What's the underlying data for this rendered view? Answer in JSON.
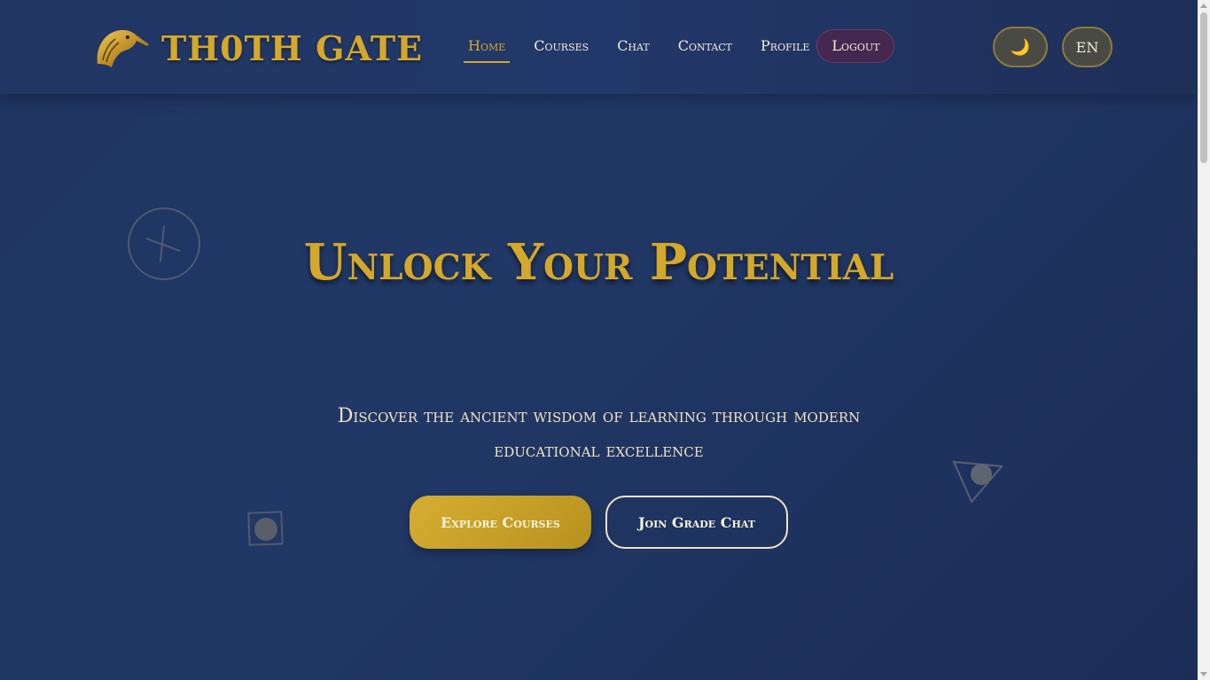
{
  "brand": {
    "name": "TH0TH GATE",
    "logo_icon": "ibis-head-icon"
  },
  "nav": {
    "items": [
      {
        "label": "Home",
        "active": true
      },
      {
        "label": "Courses",
        "active": false
      },
      {
        "label": "Chat",
        "active": false
      },
      {
        "label": "Contact",
        "active": false
      },
      {
        "label": "Profile",
        "active": false
      }
    ],
    "logout_label": "Logout"
  },
  "controls": {
    "theme_icon": "moon-icon",
    "theme_glyph": "🌙",
    "language_label": "EN"
  },
  "hero": {
    "title": "Unlock Your Potential",
    "subtitle": "Discover the ancient wisdom of learning through modern educational excellence",
    "primary_button": "Explore Courses",
    "secondary_button": "Join Grade Chat"
  },
  "colors": {
    "background": "#213866",
    "gold": "#d4a82a",
    "cream": "#efe3c4",
    "logout_bg": "#45284f"
  }
}
